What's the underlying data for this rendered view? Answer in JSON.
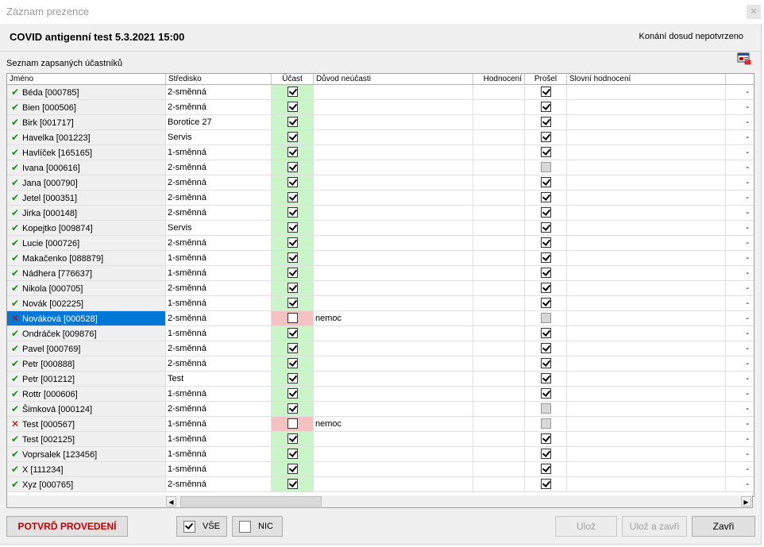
{
  "window": {
    "title": "Záznam prezence",
    "close_icon": "close-icon"
  },
  "header": {
    "test_title": "COVID antigenní test 5.3.2021 15:00",
    "status": "Konání dosud nepotvrzeno"
  },
  "list_label": "Seznam zapsaných účastníků",
  "columns": {
    "name": "Jméno",
    "center": "Středisko",
    "participation": "Účast",
    "reason": "Důvod neúčasti",
    "rating": "Hodnocení",
    "passed": "Prošel",
    "verbal": "Slovní hodnocení"
  },
  "rows": [
    {
      "name": "Béda [000785]",
      "center": "2-směnná",
      "present": true,
      "reason": "",
      "passed": true,
      "end": "-"
    },
    {
      "name": "Bien [000506]",
      "center": "2-směnná",
      "present": true,
      "reason": "",
      "passed": true,
      "end": "-"
    },
    {
      "name": "Birk [001717]",
      "center": "Borotice 27",
      "present": true,
      "reason": "",
      "passed": true,
      "end": "-"
    },
    {
      "name": "Havelka [001223]",
      "center": "Servis",
      "present": true,
      "reason": "",
      "passed": true,
      "end": "-"
    },
    {
      "name": "Havlíček [165165]",
      "center": "1-směnná",
      "present": true,
      "reason": "",
      "passed": true,
      "end": "-"
    },
    {
      "name": "Ivana [000616]",
      "center": "2-směnná",
      "present": true,
      "reason": "",
      "passed": false,
      "end": "-"
    },
    {
      "name": "Jana [000790]",
      "center": "2-směnná",
      "present": true,
      "reason": "",
      "passed": true,
      "end": "-"
    },
    {
      "name": "Jetel [000351]",
      "center": "2-směnná",
      "present": true,
      "reason": "",
      "passed": true,
      "end": "-"
    },
    {
      "name": "Jirka [000148]",
      "center": "2-směnná",
      "present": true,
      "reason": "",
      "passed": true,
      "end": "-"
    },
    {
      "name": "Kopejtko [009874]",
      "center": "Servis",
      "present": true,
      "reason": "",
      "passed": true,
      "end": "-"
    },
    {
      "name": "Lucie [000726]",
      "center": "2-směnná",
      "present": true,
      "reason": "",
      "passed": true,
      "end": "-"
    },
    {
      "name": "Makačenko [088879]",
      "center": "1-směnná",
      "present": true,
      "reason": "",
      "passed": true,
      "end": "-"
    },
    {
      "name": "Nádhera [776637]",
      "center": "1-směnná",
      "present": true,
      "reason": "",
      "passed": true,
      "end": "-"
    },
    {
      "name": "Nikola [000705]",
      "center": "2-směnná",
      "present": true,
      "reason": "",
      "passed": true,
      "end": "-"
    },
    {
      "name": "Novák [002225]",
      "center": "1-směnná",
      "present": true,
      "reason": "",
      "passed": true,
      "end": "-"
    },
    {
      "name": "Nováková [000528]",
      "center": "2-směnná",
      "present": false,
      "reason": "nemoc",
      "passed": false,
      "end": "-",
      "selected": true
    },
    {
      "name": "Ondráček [009876]",
      "center": "1-směnná",
      "present": true,
      "reason": "",
      "passed": true,
      "end": "-"
    },
    {
      "name": "Pavel [000769]",
      "center": "2-směnná",
      "present": true,
      "reason": "",
      "passed": true,
      "end": "-"
    },
    {
      "name": "Petr [000888]",
      "center": "2-směnná",
      "present": true,
      "reason": "",
      "passed": true,
      "end": "-"
    },
    {
      "name": "Petr [001212]",
      "center": "Test",
      "present": true,
      "reason": "",
      "passed": true,
      "end": "-"
    },
    {
      "name": "Rottr [000606]",
      "center": "1-směnná",
      "present": true,
      "reason": "",
      "passed": true,
      "end": "-"
    },
    {
      "name": "Šimková [000124]",
      "center": "2-směnná",
      "present": true,
      "reason": "",
      "passed": false,
      "end": "-"
    },
    {
      "name": "Test [000567]",
      "center": "1-směnná",
      "present": false,
      "reason": "nemoc",
      "passed": false,
      "end": "-"
    },
    {
      "name": "Test [002125]",
      "center": "1-směnná",
      "present": true,
      "reason": "",
      "passed": true,
      "end": "-"
    },
    {
      "name": "Voprsalek [123456]",
      "center": "1-směnná",
      "present": true,
      "reason": "",
      "passed": true,
      "end": "-"
    },
    {
      "name": "X [111234]",
      "center": "1-směnná",
      "present": true,
      "reason": "",
      "passed": true,
      "end": "-"
    },
    {
      "name": "Xyz [000765]",
      "center": "2-směnná",
      "present": true,
      "reason": "",
      "passed": true,
      "end": "-"
    }
  ],
  "grey_passed_rows": [
    5,
    15,
    21,
    22
  ],
  "buttons": {
    "confirm": "POTVRĎ PROVEDENÍ",
    "all": "VŠE",
    "none": "NIC",
    "save": "Ulož",
    "save_close": "Ulož a zavři",
    "close": "Zavři"
  },
  "colors": {
    "present_bg": "#c9f5c9",
    "absent_bg": "#f5c1c1",
    "selected_bg": "#0078d7",
    "confirm_text": "#c00000"
  }
}
